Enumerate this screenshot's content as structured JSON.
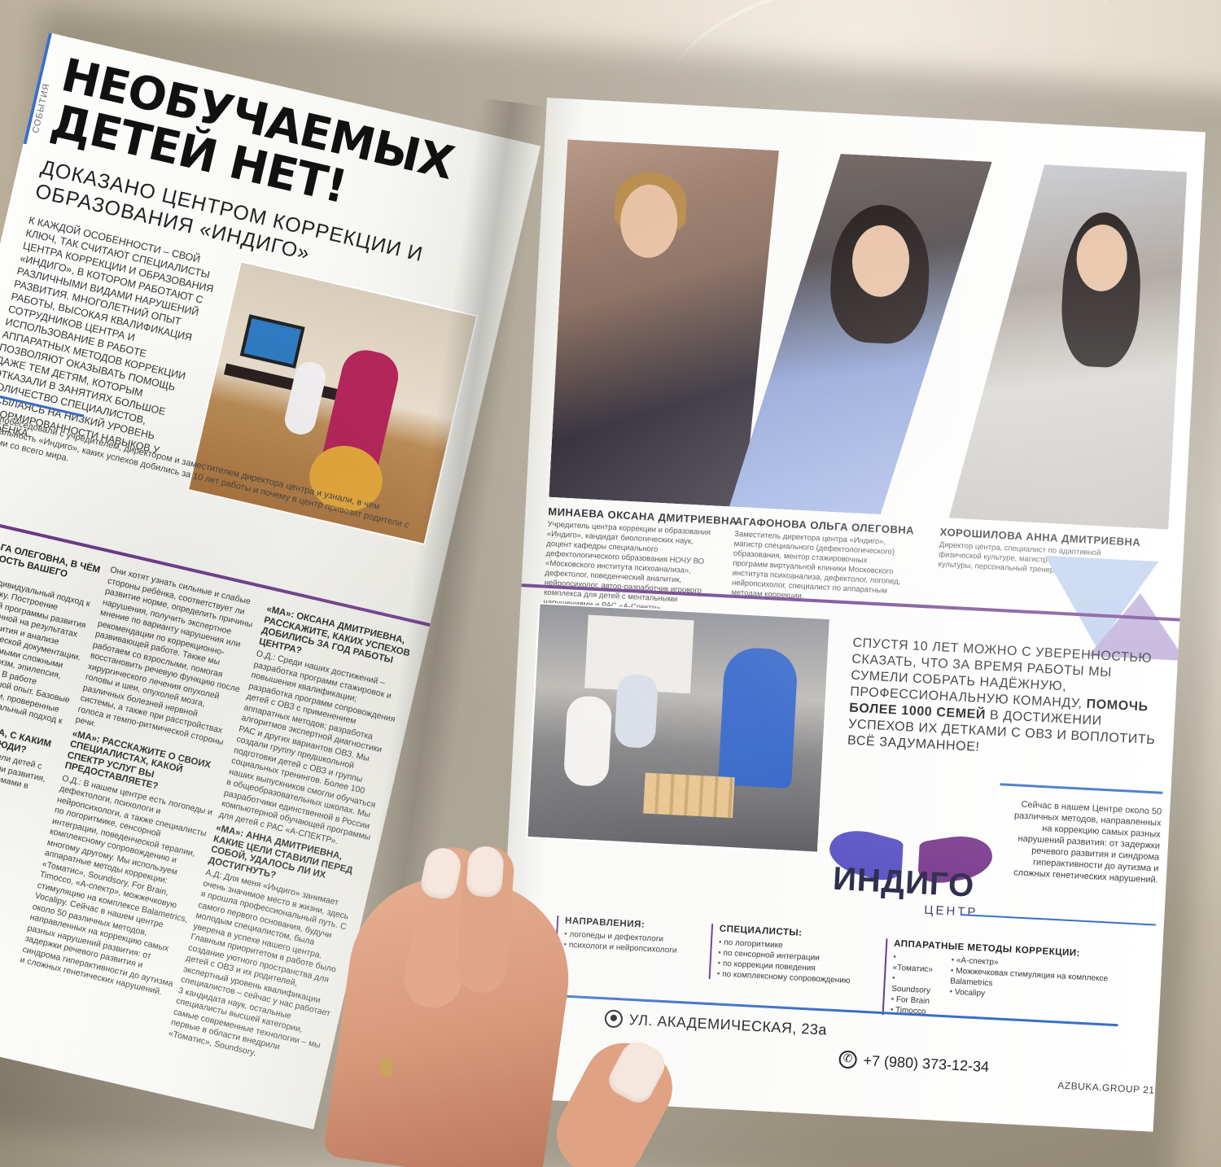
{
  "left_page": {
    "section_label": "СОБЫТИЯ",
    "headline_line1": "НЕОБУЧАЕМЫХ",
    "headline_line2": "ДЕТЕЙ НЕТ!",
    "subhead": "ДОКАЗАНО ЦЕНТРОМ КОРРЕКЦИИ И ОБРАЗОВАНИЯ «ИНДИГО»",
    "lead": "К КАЖДОЙ ОСОБЕННОСТИ – СВОЙ КЛЮЧ, ТАК СЧИТАЮТ СПЕЦИАЛИСТЫ ЦЕНТРА КОРРЕКЦИИ И ОБРАЗОВАНИЯ «ИНДИГО», В КОТОРОМ РАБОТАЮТ С РАЗЛИЧНЫМИ ВИДАМИ НАРУШЕНИЙ РАЗВИТИЯ. МНОГОЛЕТНИЙ ОПЫТ РАБОТЫ, ВЫСОКАЯ КВАЛИФИКАЦИЯ СОТРУДНИКОВ ЦЕНТРА И ИСПОЛЬЗОВАНИЕ В РАБОТЕ АППАРАТНЫХ МЕТОДОВ КОРРЕКЦИИ ПОЗВОЛЯЮТ ОКАЗЫВАТЬ ПОМОЩЬ ДАЖЕ ТЕМ ДЕТЯМ, КОТОРЫМ ОТКАЗАЛИ В ЗАНЯТИЯХ БОЛЬШОЕ КОЛИЧЕСТВО СПЕЦИАЛИСТОВ, ССЫЛАЯСЬ НА НИЗКИЙ УРОВЕНЬ СФОРМИРОВАННОСТИ НАВЫКОВ У РЕБЁНКА.",
    "intro": "Мы побеседовали с учредителем, директором и заместителем директора центра и узнали, в чём уникальность «Индиго», каких успехов добились за 10 лет работы и почему в центр привозят родители с детьми со всего мира.",
    "col_a_heading": "«МА»: ОЛЬГА ОЛЕГОВНА, В ЧЁМ УНИКАЛЬНОСТЬ ВАШЕГО ЦЕНТРА?",
    "col_a_text": "О.О.: У нас индивидуальный подход к каждому ребёнку. Построение индивидуальной программы развития ребёнка, основанной на результатах диагностики развития и анализе медико-педагогической документации. Мы работаем с самыми сложными формами ОВЗ: аутизм, эпилепсия, задержка развития. В работе опираемся на большой опыт. Базовые и авторские методики, проверенные временем. Индивидуальный подход к каждой проблеме.",
    "col_a_heading2": "«МА»: ДИМИТРЕВНА, С КАКИМ ПРИХОДЯТ К ВАМ ЛЮДИ?",
    "col_a_text2": "Нам обращаются родители детей с различными нарушениями развития, речи, поведения и проблемами в освоении программы.",
    "col_b_text": "Они хотят узнать сильные и слабые стороны ребёнка, соответствует ли развитие норме, определить причины нарушения, получить экспертное мнение по варианту нарушения или рекомендации по коррекционно-развивающей работе. Также мы работаем со взрослыми, помогая восстановить речевую функцию после хирургического лечения опухолей головы и шеи, опухолей мозга, различных болезней нервной системы, а также при расстройствах голоса и темпо-ритмической стороны речи.",
    "col_b_heading": "«МА»: РАССКАЖИТЕ О СВОИХ СПЕЦИАЛИСТАХ, КАКОЙ СПЕКТР УСЛУГ ВЫ ПРЕДОСТАВЛЯЕТЕ?",
    "col_b_text2": "О.Д.: В нашем центре есть логопеды и дефектологи, психологи и нейропсихологи, а также специалисты по логоритмике, сенсорной интеграции, поведенческой терапии, комплексному сопровождению и многому другому. Мы используем аппаратные методы коррекции: «Томатис», Soundsory, For Brain, Timocco, «А-спектр», можжечковую стимуляцию на комплексе Balametrics, Vocalipy. Сейчас в нашем центре около 50 различных методов, направленных на коррекцию самых разных нарушений развития: от задержки речевого развития и синдрома гиперактивности до аутизма и сложных генетических нарушений.",
    "col_c_heading": "«МА»: ОКСАНА ДМИТРИЕВНА, РАССКАЖИТЕ, КАКИХ УСПЕХОВ ДОБИЛИСЬ ЗА ГОД РАБОТЫ ЦЕНТРА?",
    "col_c_text": "О.Д.: Среди наших достижений – разработка программ стажировок и повышения квалификации; разработка программ сопровождения детей с ОВЗ с применением аппаратных методов; разработка алгоритмов экспертной диагностики РАС и других вариантов ОВЗ. Мы создали группу предшкольной подготовки детей с ОВЗ и группы социальных тренингов. Более 100 наших выпускников смогли обучаться в общеобразовательных школах. Мы разработчики единственной в России компьютерной обучающей программы для детей с РАС «А-СПЕКТР».",
    "col_c_heading2": "«МА»: АННА ДМИТРИЕВНА, КАКИЕ ЦЕЛИ СТАВИЛИ ПЕРЕД СОБОЙ, УДАЛОСЬ ЛИ ИХ ДОСТИГНУТЬ?",
    "col_c_text2": "А.Д: Для меня «Индиго» занимает очень значимое место в жизни, здесь я прошла профессиональный путь. С самого первого основания, будучи молодым специалистом, была уверена в успехе нашего центра. Главным приоритетом в работе было создание уютного пространства для детей с ОВЗ и их родителей, экспертный уровень квалификации специалистов – сейчас у нас работает 3 кандидата наук, остальные специалисты высшей категории, самые современные технологии – мы первые в области внедрили «Томатис», Soundsory."
  },
  "right_page": {
    "people": [
      {
        "name": "МИНАЕВА ОКСАНА ДМИТРИЕВНА",
        "bio": "Учредитель центра коррекции и образования «Индиго», кандидат биологических наук, доцент кафедры специального дефектологического образования НОЧУ ВО «Московского института психоанализа», дефектолог, поведенческий аналитик, нейропсихолог, автор-разработчик игрового комплекса для детей с ментальными нарушениями и РАС «А-Спектр»."
      },
      {
        "name": "АГАФОНОВА ОЛЬГА ОЛЕГОВНА",
        "bio": "Заместитель директора центра «Индиго», магистр специального (дефектологического) образования, ментор стажировочных программ виртуальной клиники Московского института психоанализа, дефектолог, логопед, нейропсихолог, специалист по аппаратным методам коррекции."
      },
      {
        "name": "ХОРОШИЛОВА АННА ДМИТРИЕВНА",
        "bio": "Директор центра, специалист по адаптивной физической культуре, магистр физической культуры, персональный тренер, массажист."
      }
    ],
    "quote_part1": "СПУСТЯ 10 ЛЕТ МОЖНО С УВЕРЕННОСТЬЮ СКАЗАТЬ, ЧТО ЗА ВРЕМЯ РАБОТЫ МЫ СУМЕЛИ СОБРАТЬ НАДЁЖНУЮ, ПРОФЕССИОНАЛЬНУЮ КОМАНДУ, ",
    "quote_bold": "ПОМОЧЬ БОЛЕЕ 1000 СЕМЕЙ",
    "quote_part2": " В ДОСТИЖЕНИИ УСПЕХОВ ИХ ДЕТКАМИ С ОВЗ И ВОПЛОТИТЬ ВСЁ ЗАДУМАННОЕ!",
    "methods_text": "Сейчас в нашем Центре около 50 различных методов, направленных на коррекцию самых разных нарушений развития: от задержки речевого развития и синдрома гиперактивности до аутизма и сложных генетических нарушений.",
    "logo_word": "ИНДИГО",
    "logo_sub": "ЦЕНТР",
    "directions": {
      "title": "НАПРАВЛЕНИЯ:",
      "items": [
        "логопеды и дефектологи",
        "психологи и нейропсихологи"
      ]
    },
    "specialists": {
      "title": "СПЕЦИАЛИСТЫ:",
      "items": [
        "по логоритмике",
        "по сенсорной интеграции",
        "по коррекции поведения",
        "по комплексному сопровождению"
      ]
    },
    "hardware": {
      "title": "АППАРАТНЫЕ МЕТОДЫ КОРРЕКЦИИ:",
      "col1": [
        "«Томатис»",
        "Soundsory",
        "For Brain",
        "Timocco"
      ],
      "col2": [
        "«А-спектр»",
        "Можжечковая стимуляция на комплексе Balametrics",
        "Vocalipy"
      ]
    },
    "address": "УЛ. АКАДЕМИЧЕСКАЯ, 23а",
    "phone": "+7 (980) 373-12-34",
    "page_footer": "AZBUKA.GROUP 21"
  },
  "icons": [
    "location-pin-icon",
    "phone-icon"
  ],
  "colors": {
    "accent_blue": "#3a6fc4",
    "accent_purple": "#6c3a8c",
    "triangle_blue": "#a8bfe6",
    "triangle_lilac": "#b8a9d6"
  }
}
